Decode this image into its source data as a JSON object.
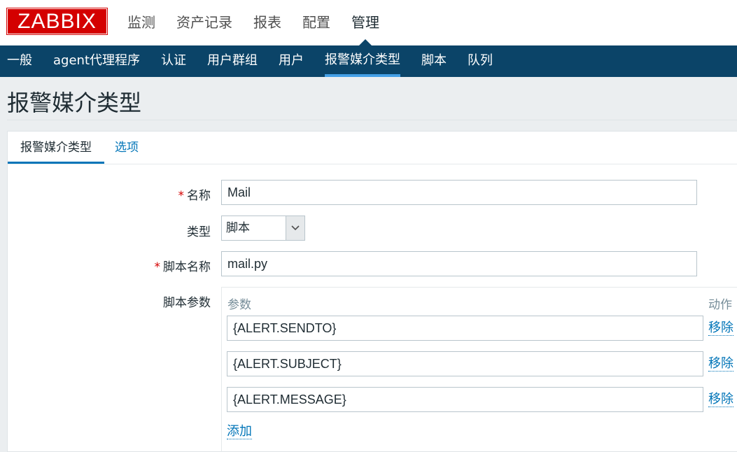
{
  "header": {
    "logo": "ZABBIX",
    "main_nav": [
      "监测",
      "资产记录",
      "报表",
      "配置",
      "管理"
    ],
    "main_nav_active": "管理"
  },
  "subnav": {
    "items": [
      "一般",
      "agent代理程序",
      "认证",
      "用户群组",
      "用户",
      "报警媒介类型",
      "脚本",
      "队列"
    ],
    "active": "报警媒介类型"
  },
  "page": {
    "title": "报警媒介类型"
  },
  "tabs": [
    "报警媒介类型",
    "选项"
  ],
  "form": {
    "required_mark": "*",
    "name_label": "名称",
    "name_value": "Mail",
    "type_label": "类型",
    "type_value": "脚本",
    "script_name_label": "脚本名称",
    "script_name_value": "mail.py",
    "script_params_label": "脚本参数",
    "params_header": {
      "param": "参数",
      "action": "动作"
    },
    "params": [
      {
        "value": "{ALERT.SENDTO}",
        "remove_label": "移除"
      },
      {
        "value": "{ALERT.SUBJECT}",
        "remove_label": "移除"
      },
      {
        "value": "{ALERT.MESSAGE}",
        "remove_label": "移除"
      }
    ],
    "add_label": "添加"
  },
  "colors": {
    "logo_red": "#d40000",
    "subnav_bg": "#0b4468",
    "active_underline": "#45a0e6",
    "link": "#0275b8"
  }
}
